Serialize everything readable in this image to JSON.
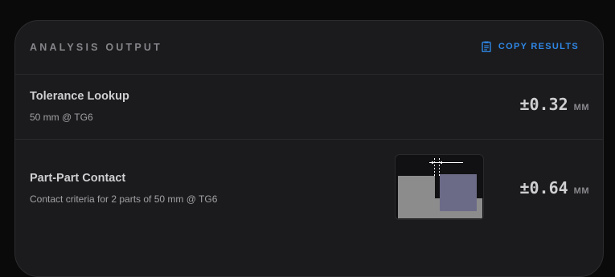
{
  "header": {
    "title": "ANALYSIS OUTPUT",
    "copy_label": "COPY RESULTS",
    "copy_icon": "clipboard-icon",
    "accent_color": "#2f86e4"
  },
  "results": [
    {
      "title": "Tolerance Lookup",
      "subtitle": "50 mm @ TG6",
      "value": "±0.32",
      "unit": "MM"
    },
    {
      "title": "Part-Part Contact",
      "subtitle": "Contact criteria for 2 parts of 50 mm @ TG6",
      "value": "±0.64",
      "unit": "MM",
      "diagram": "contact-diagram",
      "diagram_colors": {
        "part_a": "#8c8c8c",
        "part_b": "#6b6b87",
        "dimension": "#ffffff"
      }
    }
  ]
}
